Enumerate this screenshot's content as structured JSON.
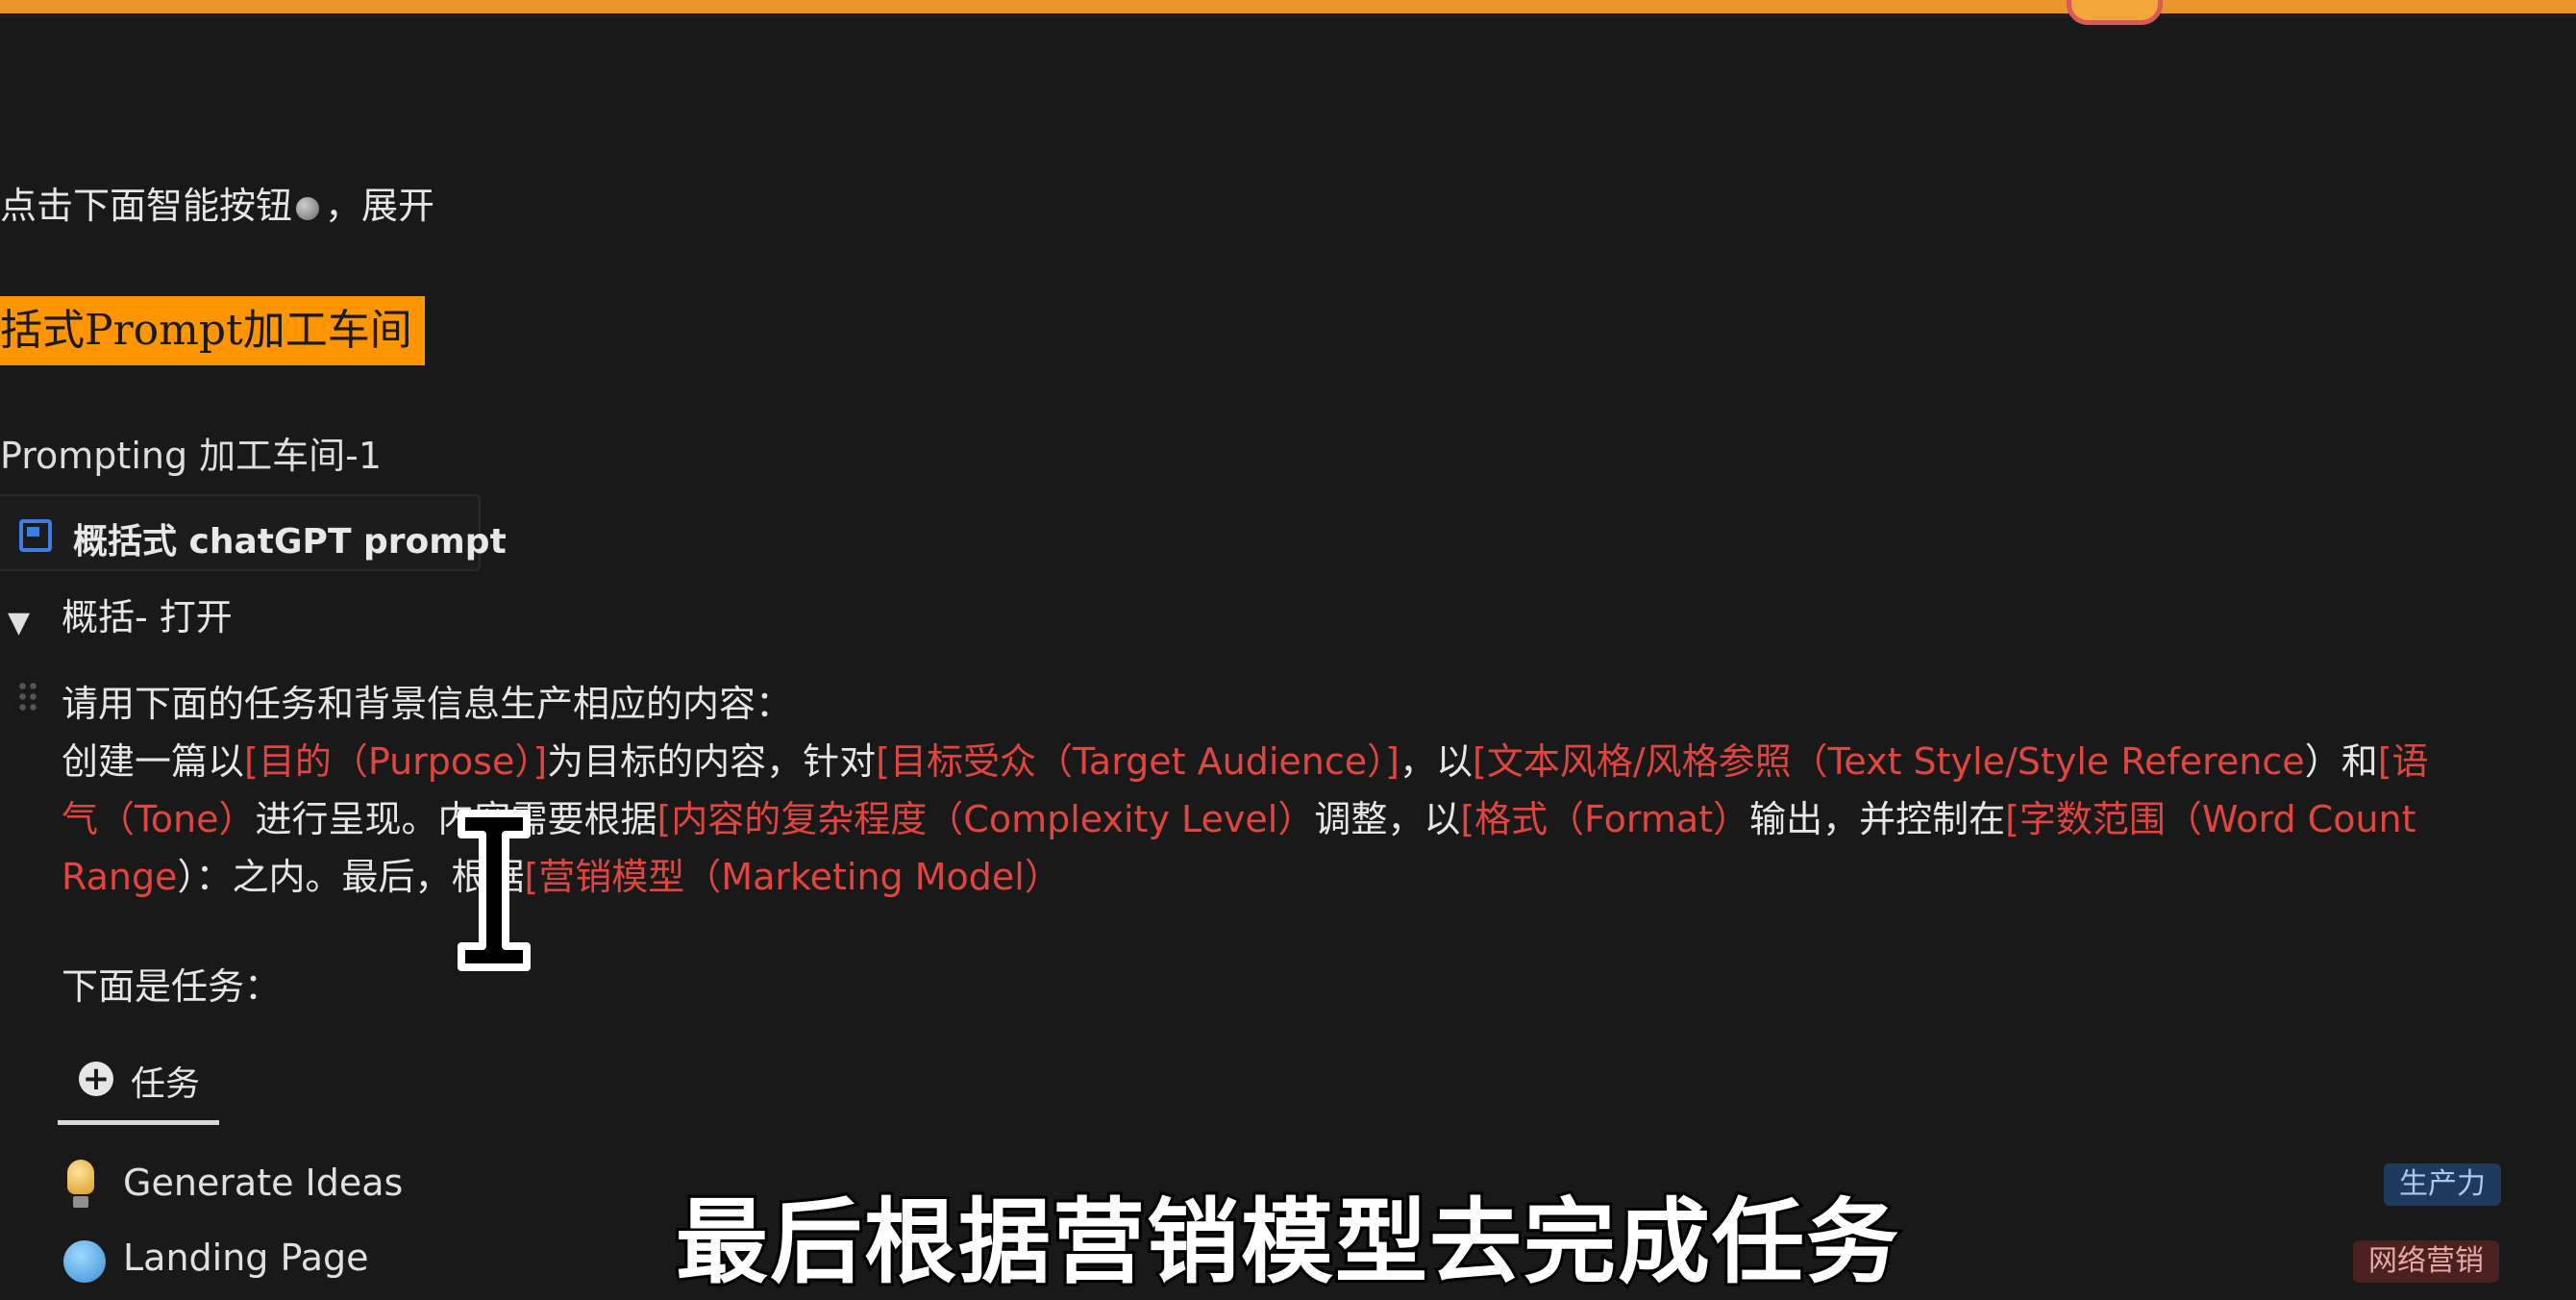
{
  "hint_text": "点击下面智能按钮",
  "hint_suffix": "，展开",
  "banner_title": "括式Prompt加工车间",
  "section_title": "Prompting 加工车间-1",
  "link_block_label": "概括式 chatGPT prompt",
  "toggle": {
    "arrow": "▼",
    "label": "概括- 打开"
  },
  "paragraph": {
    "intro": "请用下面的任务和背景信息生产相应的内容：",
    "row2": [
      {
        "text": "创建一篇以",
        "red": false
      },
      {
        "text": "[目的（Purpose）]",
        "red": true
      },
      {
        "text": "为目标的内容，针对",
        "red": false
      },
      {
        "text": "[目标受众（Target Audience）]",
        "red": true
      },
      {
        "text": "，以",
        "red": false
      },
      {
        "text": "[文本风格/风格参照（Text Style/Style Reference",
        "red": true
      },
      {
        "text": "）和",
        "red": false
      },
      {
        "text": "[语",
        "red": true
      }
    ],
    "row3": [
      {
        "text": "气（Tone）",
        "red": true
      },
      {
        "text": "进行呈现。内容需要根据",
        "red": false
      },
      {
        "text": "[内容的复杂程度（Complexity Level）",
        "red": true
      },
      {
        "text": "调整，以",
        "red": false
      },
      {
        "text": "[格式（Format）",
        "red": true
      },
      {
        "text": "输出，并控制在",
        "red": false
      },
      {
        "text": "[字数范围（Word Count",
        "red": true
      }
    ],
    "row4": [
      {
        "text": "Range",
        "red": true
      },
      {
        "text": "）：之内。最后，根据",
        "red": false
      },
      {
        "text": "[营销模型（Marketing Model）",
        "red": true
      }
    ]
  },
  "task_label": "下面是任务：",
  "tab": {
    "plus": "+",
    "label": "任务"
  },
  "list": [
    {
      "label": "Generate Ideas",
      "icon": "lightbulb-icon",
      "tag": "生产力",
      "tag_color": "#1e3a5c"
    },
    {
      "label": "Landing Page",
      "icon": "globe-icon",
      "tag": "网络营销",
      "tag_color": "#4a2020"
    }
  ],
  "subtitle": "最后根据营销模型去完成任务",
  "colors": {
    "accent_orange": "#ff9500",
    "highlight_red": "#e0453f",
    "background": "#191919"
  }
}
